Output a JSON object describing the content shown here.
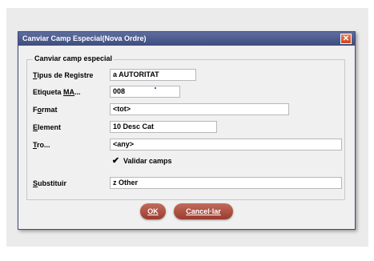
{
  "window": {
    "title": "Canviar Camp Especial(Nova Ordre)",
    "close_glyph": "✕"
  },
  "group": {
    "title": "Canviar camp especial"
  },
  "fields": {
    "tipus_de_registre": {
      "label": "Tipus de Registre",
      "underline": "T",
      "rest": "ipus de Registre",
      "value": "a  AUTORITAT"
    },
    "etiqueta": {
      "label": "Etiqueta MA...",
      "prefix": "Etiqueta ",
      "underline": "MA",
      "rest": "...",
      "value": "008"
    },
    "format": {
      "label": "Format",
      "prefix": "F",
      "underline": "o",
      "rest": "rmat",
      "value": "<tot>"
    },
    "element": {
      "label": "Element",
      "underline": "E",
      "rest": "lement",
      "value": "10  Desc Cat"
    },
    "tro": {
      "label": "Tro...",
      "underline": "T",
      "rest": "ro...",
      "value": "<any>"
    },
    "substituir": {
      "label": "Substituir",
      "prefix": "",
      "underline": "S",
      "rest": "ubstituir",
      "value": "z Other"
    }
  },
  "checkbox": {
    "label_underline": "V",
    "label_rest": "alidar camps",
    "checked_glyph": "✔"
  },
  "buttons": {
    "ok": "OK",
    "cancel": "Cancel·lar"
  },
  "colors": {
    "title_bar": "#3e4d7f",
    "button": "#9a3b2e",
    "close": "#c9461f"
  }
}
